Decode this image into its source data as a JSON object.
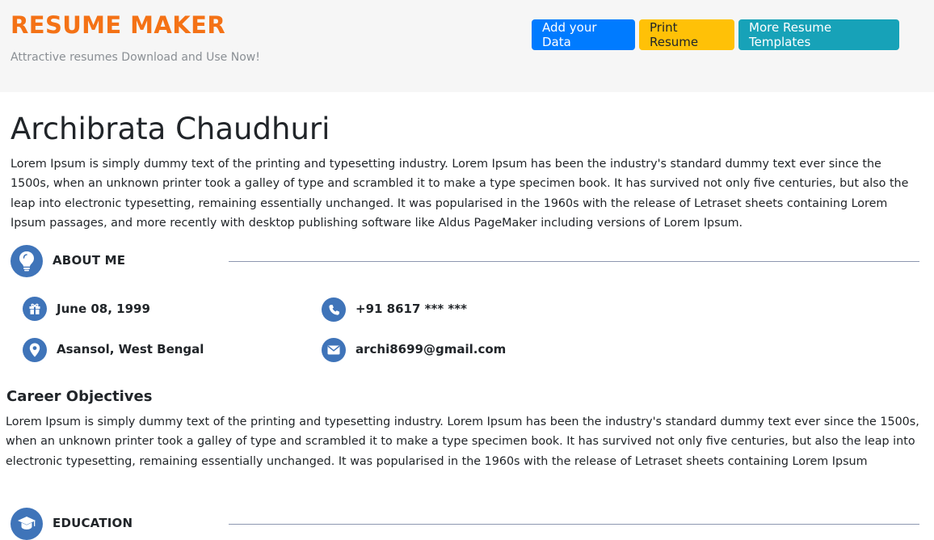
{
  "header": {
    "brand": "RESUME MAKER",
    "tagline": "Attractive resumes Download and Use Now!",
    "buttons": {
      "add_data": "Add your Data",
      "print": "Print Resume",
      "more_templates": "More Resume Templates"
    }
  },
  "profile": {
    "name": "Archibrata Chaudhuri",
    "summary": "Lorem Ipsum is simply dummy text of the printing and typesetting industry. Lorem Ipsum has been the industry's standard dummy text ever since the 1500s, when an unknown printer took a galley of type and scrambled it to make a type specimen book. It has survived not only five centuries, but also the leap into electronic typesetting, remaining essentially unchanged. It was popularised in the 1960s with the release of Letraset sheets containing Lorem Ipsum passages, and more recently with desktop publishing software like Aldus PageMaker including versions of Lorem Ipsum."
  },
  "about": {
    "title": "ABOUT ME",
    "icon": "lightbulb-icon",
    "birthday": "June 08, 1999",
    "phone": "+91 8617 *** ***",
    "location": "Asansol, West Bengal",
    "email": "archi8699@gmail.com"
  },
  "career": {
    "title": "Career Objectives",
    "text": "Lorem Ipsum is simply dummy text of the printing and typesetting industry. Lorem Ipsum has been the industry's standard dummy text ever since the 1500s, when an unknown printer took a galley of type and scrambled it to make a type specimen book. It has survived not only five centuries, but also the leap into electronic typesetting, remaining essentially unchanged. It was popularised in the 1960s with the release of Letraset sheets containing Lorem Ipsum passages,"
  },
  "education": {
    "title": "EDUCATION",
    "icon": "graduation-cap-icon"
  },
  "colors": {
    "brand": "#f47216",
    "primary": "#007bff",
    "warning": "#ffc107",
    "info": "#17a2b8",
    "icon_bg": "#3f74b9"
  }
}
